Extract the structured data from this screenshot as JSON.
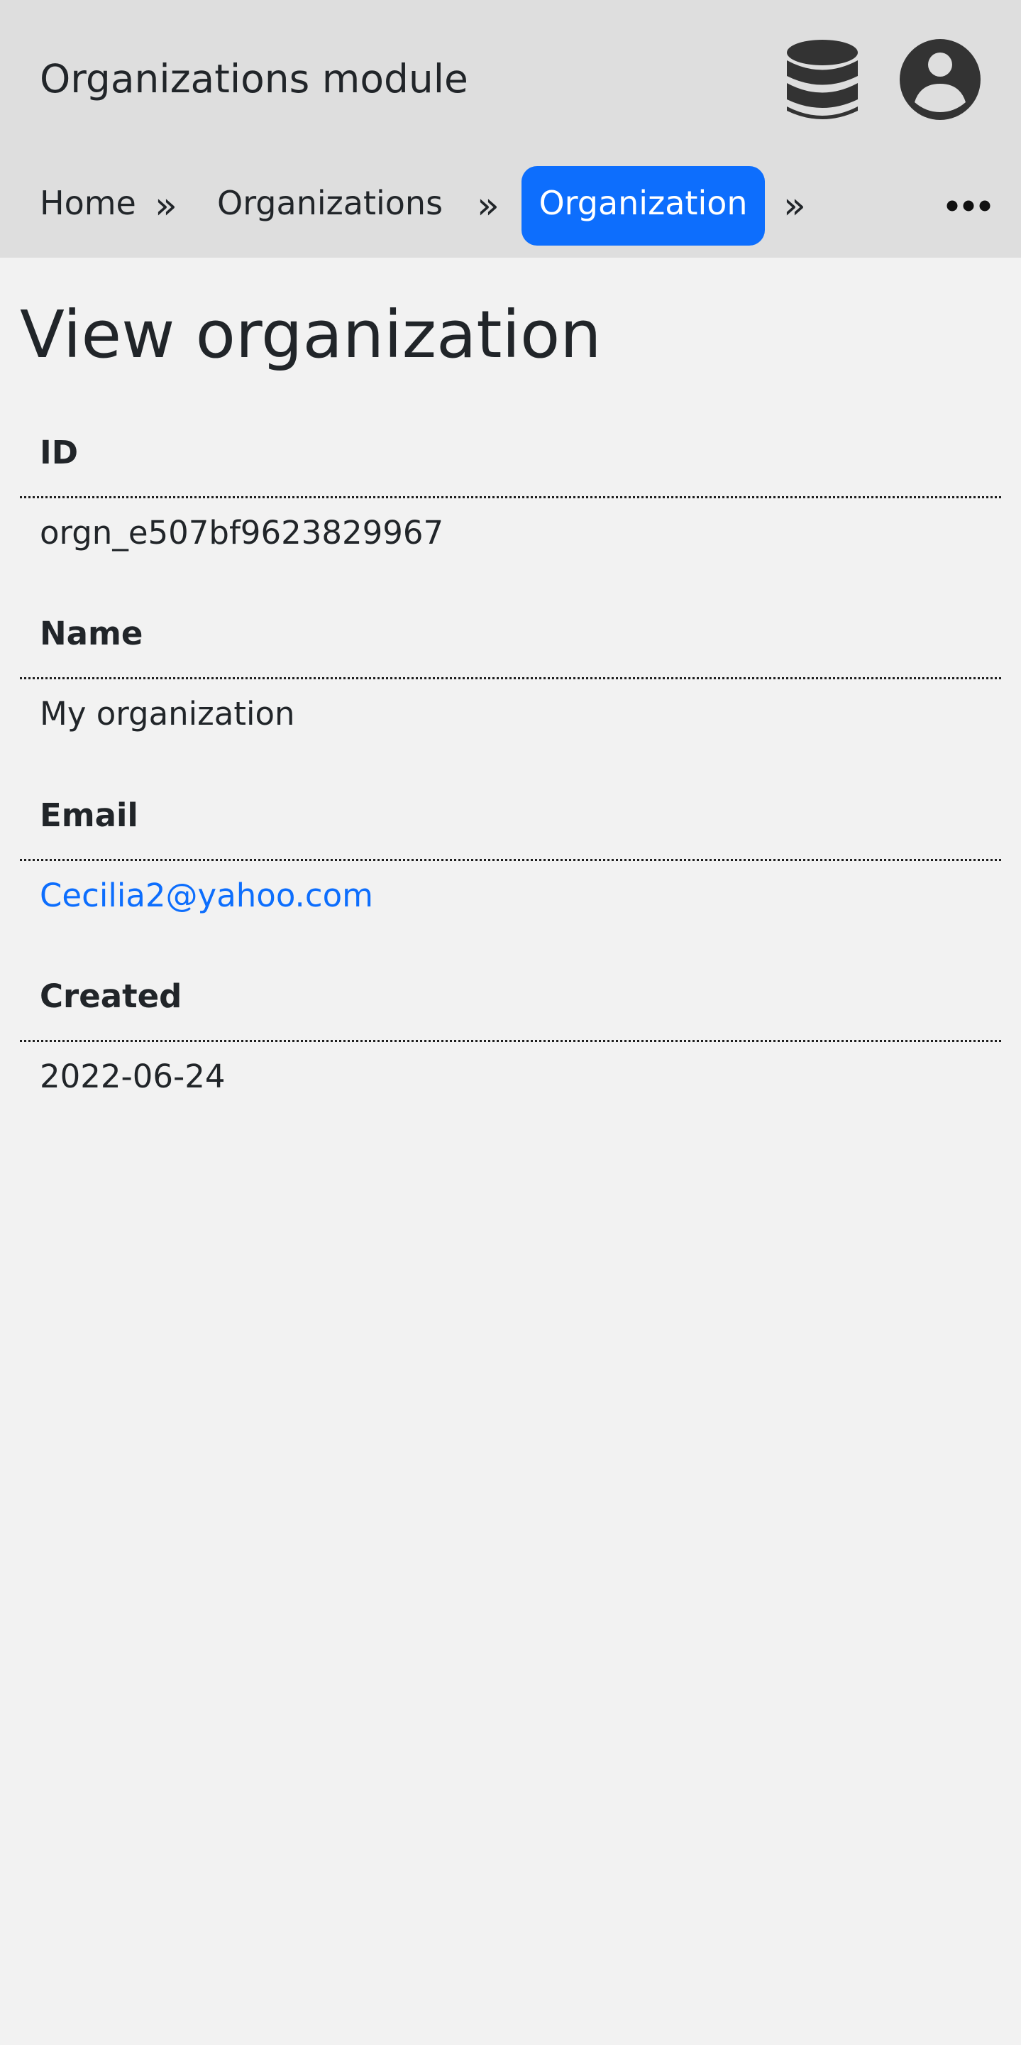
{
  "header": {
    "title": "Organizations module",
    "database_icon": "database-icon",
    "user_icon": "user-circle-icon"
  },
  "breadcrumb": {
    "items": [
      {
        "label": "Home"
      },
      {
        "label": "Organizations"
      },
      {
        "label": "Organization",
        "active": true
      }
    ],
    "separator": "»",
    "more_icon": "ellipsis-icon"
  },
  "main": {
    "title": "View organization",
    "fields": [
      {
        "label": "ID",
        "value": "orgn_e507bf9623829967"
      },
      {
        "label": "Name",
        "value": "My organization"
      },
      {
        "label": "Email",
        "value": "Cecilia2@yahoo.com"
      },
      {
        "label": "Created",
        "value": "2022-06-24"
      }
    ]
  },
  "colors": {
    "header_bg": "#dedede",
    "page_bg": "#f2f2f2",
    "accent": "#0d6efd",
    "text": "#212529",
    "icon": "#333333"
  }
}
